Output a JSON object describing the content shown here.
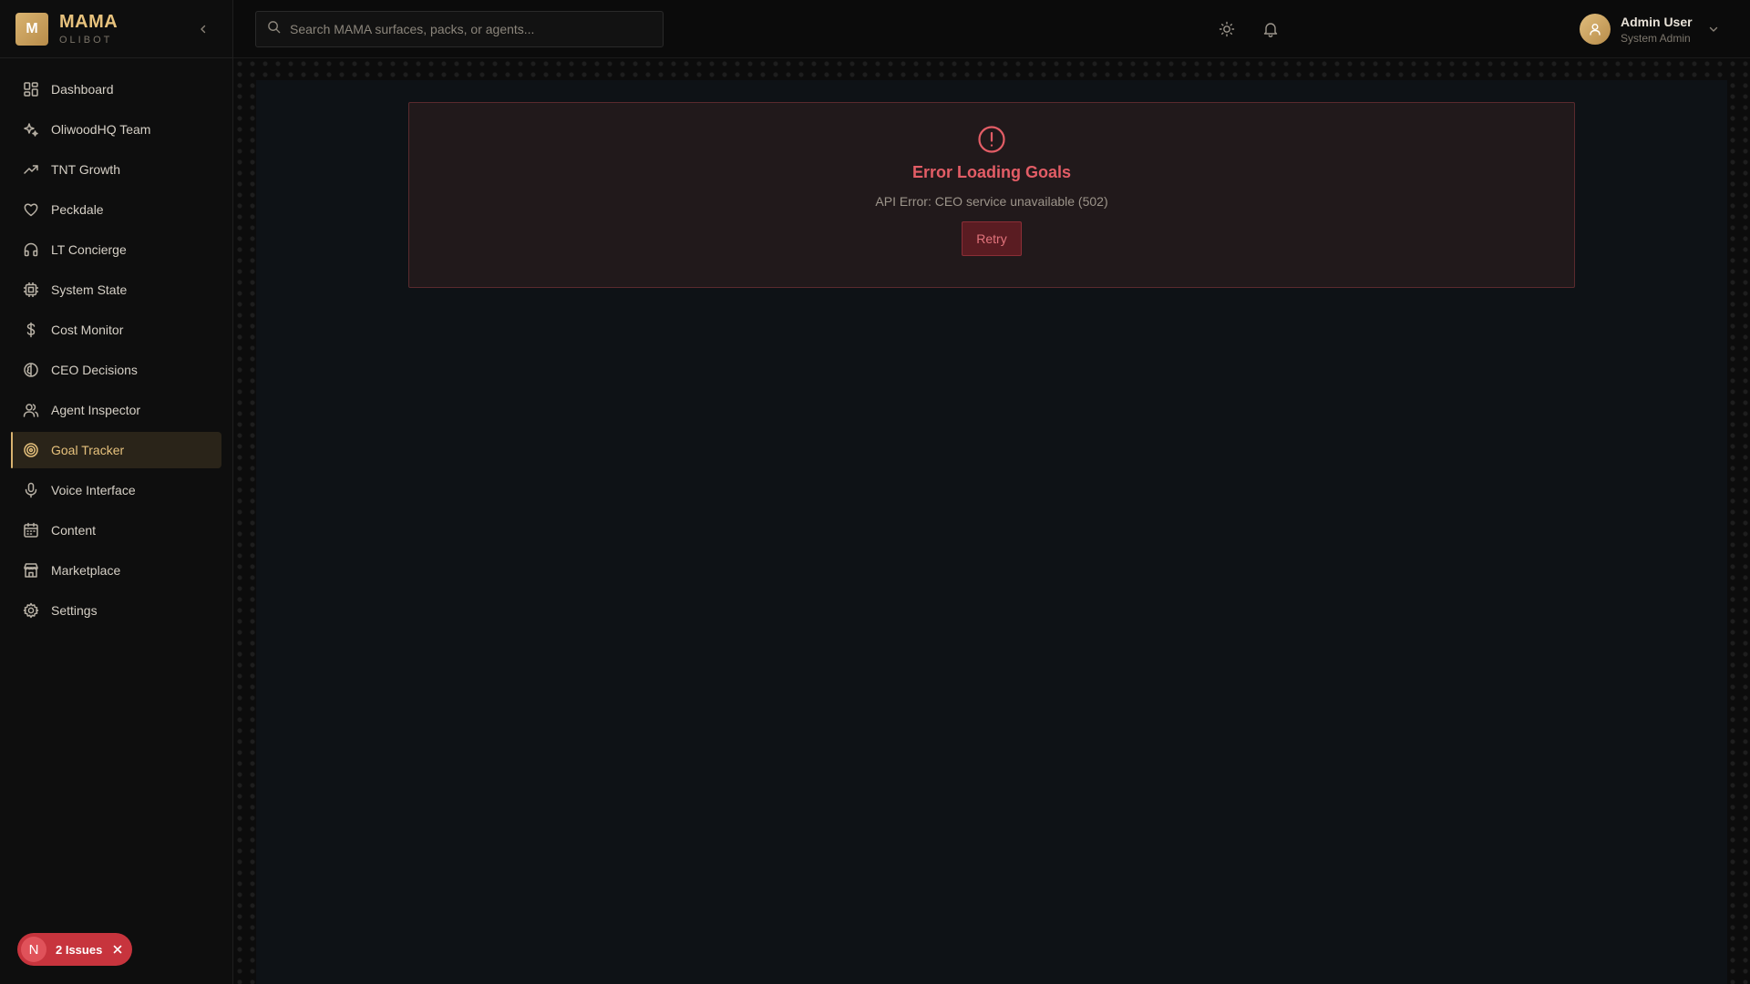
{
  "brand": {
    "logo_letter": "M",
    "name": "MAMA",
    "subtitle": "OLIBOT"
  },
  "search": {
    "placeholder": "Search MAMA surfaces, packs, or agents..."
  },
  "sidebar": {
    "items": [
      {
        "label": "Dashboard",
        "icon": "dashboard-icon"
      },
      {
        "label": "OliwoodHQ Team",
        "icon": "sparkles-icon"
      },
      {
        "label": "TNT Growth",
        "icon": "trending-up-icon"
      },
      {
        "label": "Peckdale",
        "icon": "heart-icon"
      },
      {
        "label": "LT Concierge",
        "icon": "headphones-icon"
      },
      {
        "label": "System State",
        "icon": "cpu-icon"
      },
      {
        "label": "Cost Monitor",
        "icon": "dollar-icon"
      },
      {
        "label": "CEO Decisions",
        "icon": "brain-icon"
      },
      {
        "label": "Agent Inspector",
        "icon": "users-icon"
      },
      {
        "label": "Goal Tracker",
        "icon": "target-icon",
        "active": true
      },
      {
        "label": "Voice Interface",
        "icon": "mic-icon"
      },
      {
        "label": "Content",
        "icon": "calendar-icon"
      },
      {
        "label": "Marketplace",
        "icon": "store-icon"
      },
      {
        "label": "Settings",
        "icon": "gear-icon"
      }
    ]
  },
  "issues": {
    "avatar_letter": "N",
    "label": "2 Issues"
  },
  "user": {
    "name": "Admin User",
    "role": "System Admin"
  },
  "error": {
    "title": "Error Loading Goals",
    "message": "API Error: CEO service unavailable (502)",
    "retry_label": "Retry"
  },
  "colors": {
    "accent": "#d9b370",
    "error": "#e35d66",
    "issues": "#c7343d"
  }
}
